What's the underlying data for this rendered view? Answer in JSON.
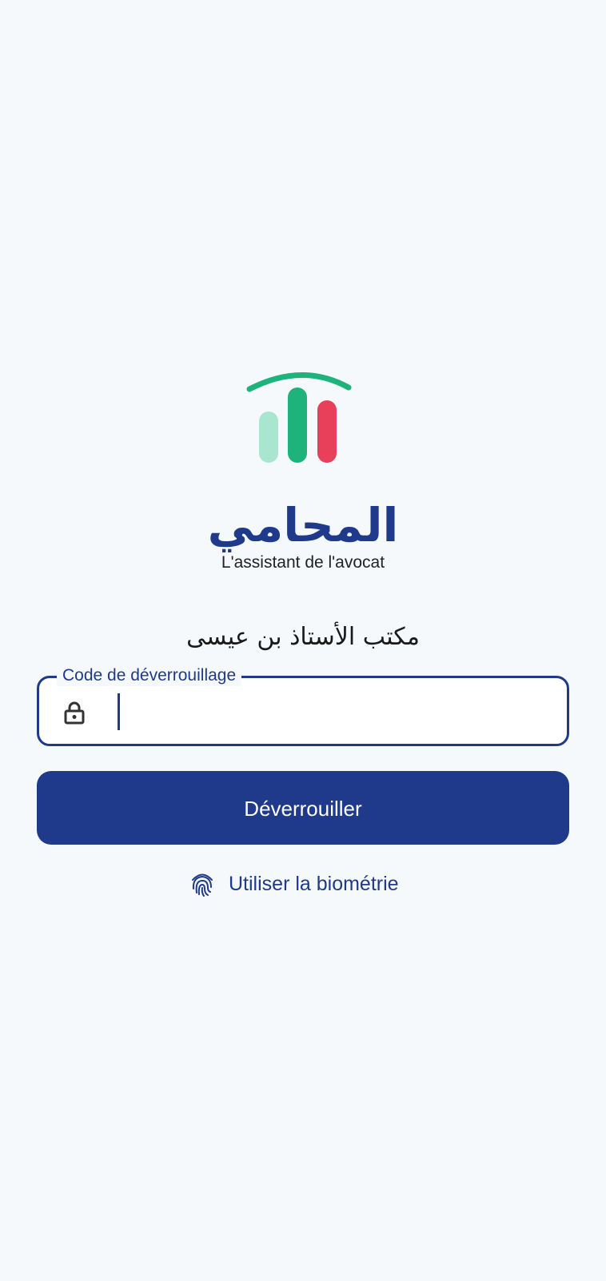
{
  "brand": {
    "name_ar": "المحامي",
    "tagline": "L'assistant de l'avocat",
    "colors": {
      "primary": "#1f3a8a",
      "green": "#1db37a",
      "light_green": "#a8e6cf",
      "red": "#e8405a",
      "background": "#f6f9fc"
    }
  },
  "office": {
    "name": "مكتب الأستاذ بن عيسى"
  },
  "unlock_form": {
    "code_label": "Code de déverrouillage",
    "code_value": "",
    "lock_icon": "lock-icon",
    "submit_label": "Déverrouiller",
    "biometric_label": "Utiliser la biométrie",
    "biometric_icon": "fingerprint-icon"
  }
}
